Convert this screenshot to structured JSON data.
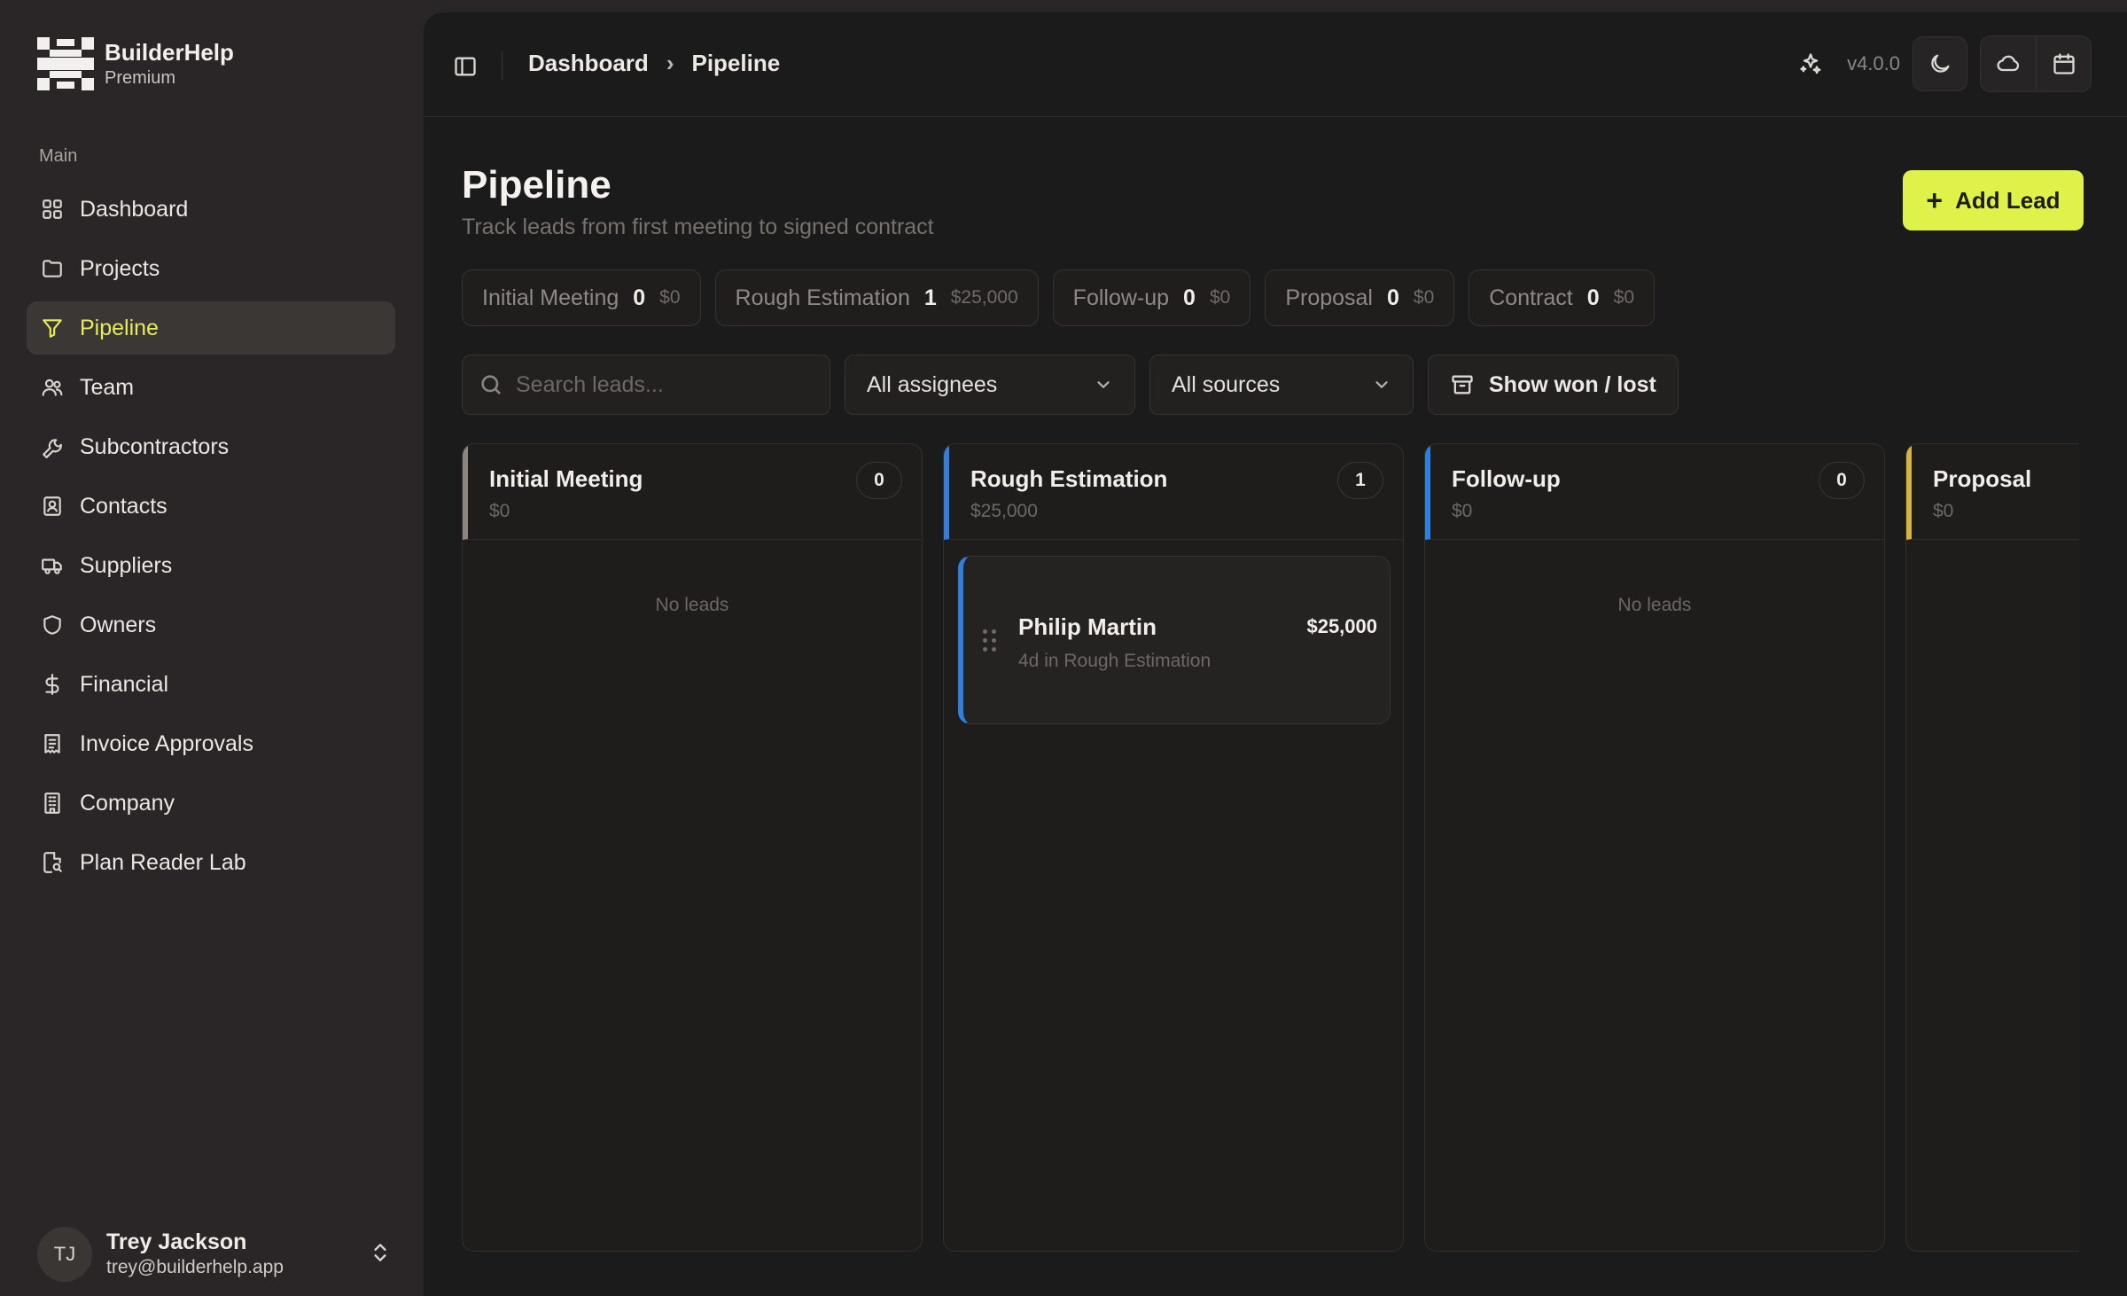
{
  "brand": {
    "name": "BuilderHelp",
    "plan": "Premium"
  },
  "sidebar": {
    "section_label": "Main",
    "items": [
      {
        "label": "Dashboard",
        "icon": "grid-icon"
      },
      {
        "label": "Projects",
        "icon": "folder-icon"
      },
      {
        "label": "Pipeline",
        "icon": "filter-icon",
        "active": true
      },
      {
        "label": "Team",
        "icon": "users-icon"
      },
      {
        "label": "Subcontractors",
        "icon": "wrench-icon"
      },
      {
        "label": "Contacts",
        "icon": "contact-card-icon"
      },
      {
        "label": "Suppliers",
        "icon": "truck-icon"
      },
      {
        "label": "Owners",
        "icon": "shield-icon"
      },
      {
        "label": "Financial",
        "icon": "dollar-icon"
      },
      {
        "label": "Invoice Approvals",
        "icon": "receipt-icon"
      },
      {
        "label": "Company",
        "icon": "building-icon"
      },
      {
        "label": "Plan Reader Lab",
        "icon": "file-search-icon"
      }
    ]
  },
  "user": {
    "initials": "TJ",
    "name": "Trey Jackson",
    "email": "trey@builderhelp.app"
  },
  "topbar": {
    "breadcrumb": [
      "Dashboard",
      "Pipeline"
    ],
    "breadcrumb_separator": "›",
    "version": "v4.0.0"
  },
  "page": {
    "title": "Pipeline",
    "subtitle": "Track leads from first meeting to signed contract",
    "add_button": "Add Lead"
  },
  "stages": [
    {
      "name": "Initial Meeting",
      "count": "0",
      "value": "$0"
    },
    {
      "name": "Rough Estimation",
      "count": "1",
      "value": "$25,000"
    },
    {
      "name": "Follow-up",
      "count": "0",
      "value": "$0"
    },
    {
      "name": "Proposal",
      "count": "0",
      "value": "$0"
    },
    {
      "name": "Contract",
      "count": "0",
      "value": "$0"
    }
  ],
  "filters": {
    "search_placeholder": "Search leads...",
    "assignees": "All assignees",
    "sources": "All sources",
    "won_lost": "Show won / lost"
  },
  "board": {
    "empty_text": "No leads",
    "columns": [
      {
        "name": "Initial Meeting",
        "value": "$0",
        "count": "0",
        "color": "#8a8580"
      },
      {
        "name": "Rough Estimation",
        "value": "$25,000",
        "count": "1",
        "color": "#2f7fe0",
        "leads": [
          {
            "name": "Philip Martin",
            "amount": "$25,000",
            "meta": "4d in Rough Estimation"
          }
        ]
      },
      {
        "name": "Follow-up",
        "value": "$0",
        "count": "0",
        "color": "#2f7fe0"
      },
      {
        "name": "Proposal",
        "value": "$0",
        "count": "0",
        "color": "#d8b43a"
      }
    ]
  },
  "colors": {
    "accent": "#dff24a",
    "active_nav": "#e6ea5c",
    "background": "#1c1b1b"
  }
}
